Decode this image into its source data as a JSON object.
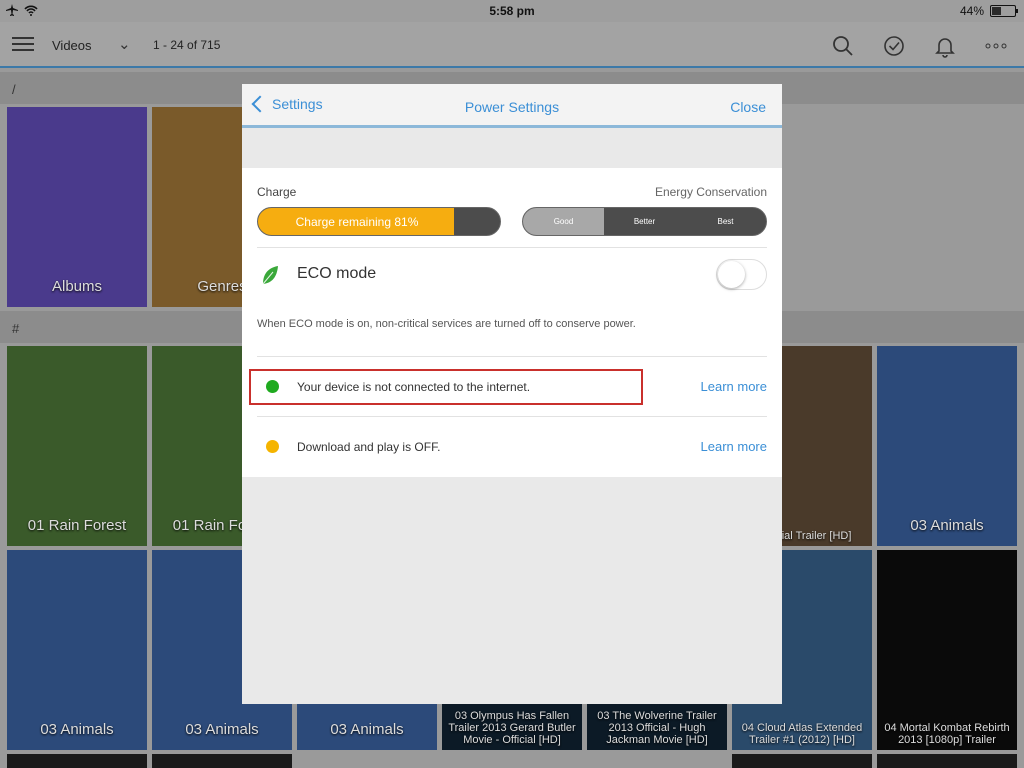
{
  "status_bar": {
    "time": "5:58 pm",
    "battery": "44%",
    "battery_level": 0.44
  },
  "toolbar": {
    "title": "Videos",
    "count": "1 - 24 of 715"
  },
  "background": {
    "section_slash": "/",
    "section_hash": "#",
    "top_tiles": [
      {
        "label": "Albums",
        "color": "#4a3a8c"
      },
      {
        "label": "Genres",
        "color": "#7a5a2a"
      }
    ],
    "grid_row1": [
      {
        "label": "01 Rain Forest",
        "color": "#3a5a2a"
      },
      {
        "label": "01 Rain Forest",
        "color": "#3a5a2a"
      },
      {
        "label": "- Official Trailer [HD]",
        "color": "#4a3a2a"
      },
      {
        "label": "03 Animals",
        "color": "#2c4a7a"
      }
    ],
    "grid_row2": [
      {
        "label": "03 Animals",
        "color": "#2c4a7a"
      },
      {
        "label": "03 Animals",
        "color": "#2c4a7a"
      },
      {
        "label": "03 Animals",
        "color": "#2c4a7a"
      },
      {
        "label": "03 Olympus Has Fallen Trailer 2013 Gerard Butler Movie - Official [HD]",
        "color": "#0c1a26"
      },
      {
        "label": "03 The Wolverine Trailer 2013 Official - Hugh Jackman Movie [HD]",
        "color": "#0c1a26"
      },
      {
        "label": "04 Cloud Atlas Extended Trailer #1 (2012) [HD]",
        "color": "#2a4a6a"
      },
      {
        "label": "04 Mortal Kombat Rebirth 2013 [1080p] Trailer",
        "color": "#0a0a0a"
      }
    ]
  },
  "modal": {
    "back_label": "Settings",
    "title": "Power Settings",
    "close_label": "Close",
    "charge_label": "Charge",
    "charge_text": "Charge remaining 81%",
    "charge_level": 0.81,
    "energy_label": "Energy Conservation",
    "energy_options": [
      "Good",
      "Better",
      "Best"
    ],
    "energy_selected": "Good",
    "eco_title": "ECO mode",
    "eco_on": false,
    "eco_description": "When ECO mode is on, non-critical services are turned off to conserve power.",
    "statuses": [
      {
        "text": "Your device is not connected to the internet.",
        "link": "Learn more",
        "color": "#1faa1f"
      },
      {
        "text": "Download and play is OFF.",
        "link": "Learn more",
        "color": "#f5b400"
      }
    ]
  },
  "colors": {
    "accent": "#3b8fd6",
    "charge": "#f6ad10",
    "highlight": "#c9302c"
  }
}
